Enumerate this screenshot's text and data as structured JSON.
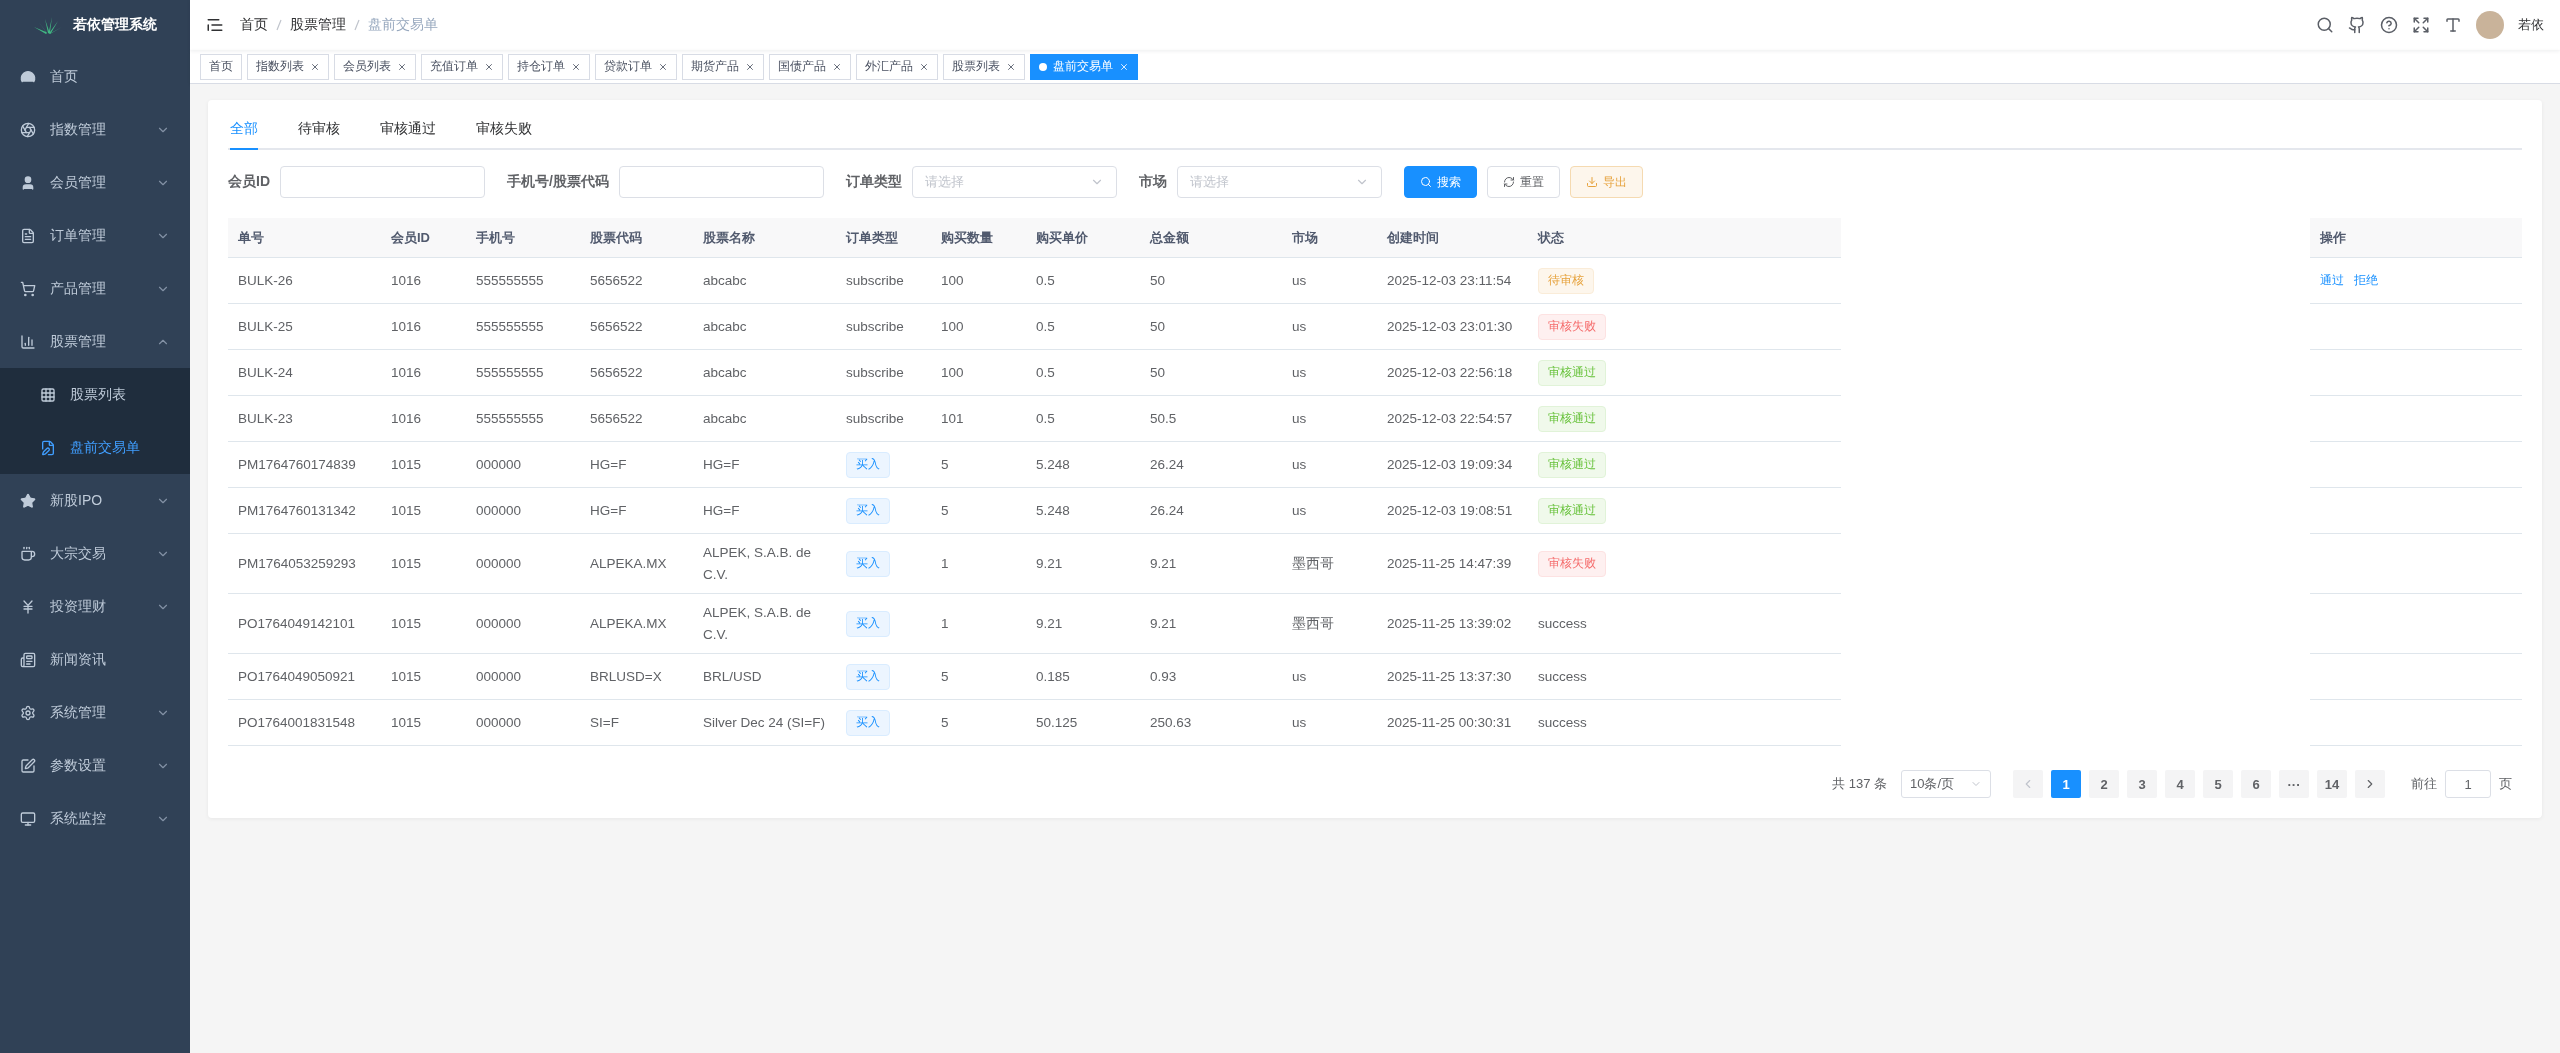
{
  "app": {
    "title": "若依管理系统"
  },
  "sidebar": {
    "items": [
      {
        "label": "首页",
        "expandable": false,
        "selected": false
      },
      {
        "label": "指数管理",
        "expandable": true,
        "expanded": false,
        "selected": false
      },
      {
        "label": "会员管理",
        "expandable": true,
        "expanded": false,
        "selected": false
      },
      {
        "label": "订单管理",
        "expandable": true,
        "expanded": false,
        "selected": false
      },
      {
        "label": "产品管理",
        "expandable": true,
        "expanded": false,
        "selected": false
      },
      {
        "label": "股票管理",
        "expandable": true,
        "expanded": true,
        "selected": false,
        "children": [
          {
            "label": "股票列表",
            "selected": false
          },
          {
            "label": "盘前交易单",
            "selected": true
          }
        ]
      },
      {
        "label": "新股IPO",
        "expandable": true,
        "expanded": false,
        "selected": false
      },
      {
        "label": "大宗交易",
        "expandable": true,
        "expanded": false,
        "selected": false
      },
      {
        "label": "投资理财",
        "expandable": true,
        "expanded": false,
        "selected": false
      },
      {
        "label": "新闻资讯",
        "expandable": false,
        "selected": false
      },
      {
        "label": "系统管理",
        "expandable": true,
        "expanded": false,
        "selected": false
      },
      {
        "label": "参数设置",
        "expandable": true,
        "expanded": false,
        "selected": false
      },
      {
        "label": "系统监控",
        "expandable": true,
        "expanded": false,
        "selected": false
      }
    ]
  },
  "breadcrumb": [
    "首页",
    "股票管理",
    "盘前交易单"
  ],
  "user": {
    "name": "若依"
  },
  "tags": [
    {
      "label": "首页",
      "closable": false,
      "selected": false
    },
    {
      "label": "指数列表",
      "closable": true,
      "selected": false
    },
    {
      "label": "会员列表",
      "closable": true,
      "selected": false
    },
    {
      "label": "充值订单",
      "closable": true,
      "selected": false
    },
    {
      "label": "持仓订单",
      "closable": true,
      "selected": false
    },
    {
      "label": "贷款订单",
      "closable": true,
      "selected": false
    },
    {
      "label": "期货产品",
      "closable": true,
      "selected": false
    },
    {
      "label": "国债产品",
      "closable": true,
      "selected": false
    },
    {
      "label": "外汇产品",
      "closable": true,
      "selected": false
    },
    {
      "label": "股票列表",
      "closable": true,
      "selected": false
    },
    {
      "label": "盘前交易单",
      "closable": true,
      "selected": true
    }
  ],
  "status_tabs": [
    {
      "label": "全部",
      "selected": true
    },
    {
      "label": "待审核",
      "selected": false
    },
    {
      "label": "审核通过",
      "selected": false
    },
    {
      "label": "审核失败",
      "selected": false
    }
  ],
  "filters": [
    {
      "label": "会员ID",
      "kind": "input"
    },
    {
      "label": "手机号/股票代码",
      "kind": "input"
    },
    {
      "label": "订单类型",
      "kind": "select",
      "placeholder": "请选择"
    },
    {
      "label": "市场",
      "kind": "select",
      "placeholder": "请选择"
    }
  ],
  "buttons": [
    {
      "label": "搜索",
      "kind": "primary"
    },
    {
      "label": "重置",
      "kind": "default"
    },
    {
      "label": "导出",
      "kind": "warning"
    }
  ],
  "table": {
    "columns": [
      "单号",
      "会员ID",
      "手机号",
      "股票代码",
      "股票名称",
      "订单类型",
      "购买数量",
      "购买单价",
      "总金额",
      "市场",
      "创建时间",
      "状态",
      "操作"
    ],
    "rows": [
      {
        "cells": [
          "BULK-26",
          "1016",
          "555555555",
          "5656522",
          "abcabc"
        ],
        "order_type": {
          "kind": "text",
          "label": "subscribe"
        },
        "rest": [
          "100",
          "0.5",
          "50",
          "us",
          "2025-12-03 23:11:54"
        ],
        "status": {
          "kind": "pending",
          "label": "待审核"
        },
        "actions": [
          "通过",
          "拒绝"
        ]
      },
      {
        "cells": [
          "BULK-25",
          "1016",
          "555555555",
          "5656522",
          "abcabc"
        ],
        "order_type": {
          "kind": "text",
          "label": "subscribe"
        },
        "rest": [
          "100",
          "0.5",
          "50",
          "us",
          "2025-12-03 23:01:30"
        ],
        "status": {
          "kind": "rejected",
          "label": "审核失败"
        }
      },
      {
        "cells": [
          "BULK-24",
          "1016",
          "555555555",
          "5656522",
          "abcabc"
        ],
        "order_type": {
          "kind": "text",
          "label": "subscribe"
        },
        "rest": [
          "100",
          "0.5",
          "50",
          "us",
          "2025-12-03 22:56:18"
        ],
        "status": {
          "kind": "approved",
          "label": "审核通过"
        }
      },
      {
        "cells": [
          "BULK-23",
          "1016",
          "555555555",
          "5656522",
          "abcabc"
        ],
        "order_type": {
          "kind": "text",
          "label": "subscribe"
        },
        "rest": [
          "101",
          "0.5",
          "50.5",
          "us",
          "2025-12-03 22:54:57"
        ],
        "status": {
          "kind": "approved",
          "label": "审核通过"
        }
      },
      {
        "cells": [
          "PM1764760174839",
          "1015",
          "000000",
          "HG=F",
          "HG=F"
        ],
        "order_type": {
          "kind": "tag",
          "label": "买入"
        },
        "rest": [
          "5",
          "5.248",
          "26.24",
          "us",
          "2025-12-03 19:09:34"
        ],
        "status": {
          "kind": "approved",
          "label": "审核通过"
        }
      },
      {
        "cells": [
          "PM1764760131342",
          "1015",
          "000000",
          "HG=F",
          "HG=F"
        ],
        "order_type": {
          "kind": "tag",
          "label": "买入"
        },
        "rest": [
          "5",
          "5.248",
          "26.24",
          "us",
          "2025-12-03 19:08:51"
        ],
        "status": {
          "kind": "approved",
          "label": "审核通过"
        }
      },
      {
        "cells": [
          "PM1764053259293",
          "1015",
          "000000",
          "ALPEKA.MX",
          "ALPEK, S.A.B. de C.V."
        ],
        "order_type": {
          "kind": "tag",
          "label": "买入"
        },
        "rest": [
          "1",
          "9.21",
          "9.21",
          "墨西哥",
          "2025-11-25 14:47:39"
        ],
        "status": {
          "kind": "rejected",
          "label": "审核失败"
        }
      },
      {
        "cells": [
          "PO1764049142101",
          "1015",
          "000000",
          "ALPEKA.MX",
          "ALPEK, S.A.B. de C.V."
        ],
        "order_type": {
          "kind": "tag",
          "label": "买入"
        },
        "rest": [
          "1",
          "9.21",
          "9.21",
          "墨西哥",
          "2025-11-25 13:39:02"
        ],
        "status": {
          "kind": "text",
          "label": "success"
        }
      },
      {
        "cells": [
          "PO1764049050921",
          "1015",
          "000000",
          "BRLUSD=X",
          "BRL/USD"
        ],
        "order_type": {
          "kind": "tag",
          "label": "买入"
        },
        "rest": [
          "5",
          "0.185",
          "0.93",
          "us",
          "2025-11-25 13:37:30"
        ],
        "status": {
          "kind": "text",
          "label": "success"
        }
      },
      {
        "cells": [
          "PO1764001831548",
          "1015",
          "000000",
          "SI=F",
          "Silver Dec 24 (SI=F)"
        ],
        "order_type": {
          "kind": "tag",
          "label": "买入"
        },
        "rest": [
          "5",
          "50.125",
          "250.63",
          "us",
          "2025-11-25 00:30:31"
        ],
        "status": {
          "kind": "text",
          "label": "success"
        }
      }
    ]
  },
  "pagination": {
    "total": "共 137 条",
    "page_size": "10条/页",
    "pages": [
      {
        "label": "1",
        "selected": true
      },
      {
        "label": "2",
        "selected": false
      },
      {
        "label": "3",
        "selected": false
      },
      {
        "label": "4",
        "selected": false
      },
      {
        "label": "5",
        "selected": false
      },
      {
        "label": "6",
        "selected": false
      },
      {
        "label": "···",
        "selected": false
      },
      {
        "label": "14",
        "selected": false
      }
    ],
    "goto_label": "前往",
    "goto_value": "1",
    "goto_suffix": "页"
  }
}
